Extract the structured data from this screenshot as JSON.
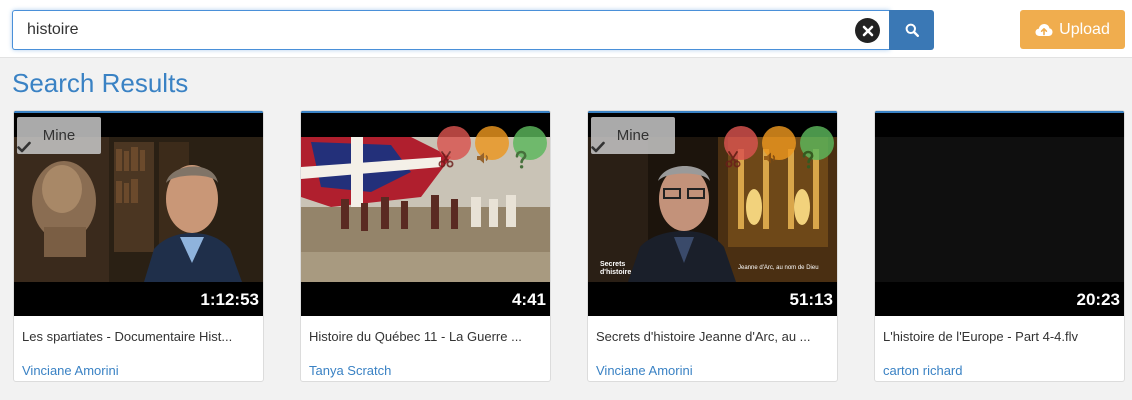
{
  "search": {
    "value": "histoire"
  },
  "header": {
    "upload_label": "Upload"
  },
  "main": {
    "title": "Search Results",
    "results": [
      {
        "mine": true,
        "mine_label": "Mine",
        "duration": "1:12:53",
        "title": "Les spartiates - Documentaire Hist...",
        "author": "Vinciane Amorini"
      },
      {
        "mine": false,
        "duration": "4:41",
        "title": "Histoire du Québec 11 - La Guerre ...",
        "author": "Tanya Scratch"
      },
      {
        "mine": true,
        "mine_label": "Mine",
        "duration": "51:13",
        "title": "Secrets d'histoire Jeanne d'Arc, au ...",
        "author": "Vinciane Amorini",
        "overlay_text_1": "Secrets d'histoire",
        "overlay_text_2": "Jeanne d'Arc, au nom de Dieu"
      },
      {
        "mine": false,
        "duration": "20:23",
        "title": "L'histoire de l'Europe - Part 4-4.flv",
        "author": "carton richard"
      }
    ]
  },
  "icons": {
    "clear": "close-circle-icon",
    "search": "search-icon",
    "upload": "cloud-upload-icon",
    "mine": "check-icon",
    "flags": [
      "scissors-icon",
      "volume-icon",
      "question-icon"
    ]
  },
  "colors": {
    "accent": "#3a82c4",
    "search_button": "#3a78b5",
    "upload_button": "#f0ad4e",
    "flag_red": "#d9534f",
    "flag_orange": "#ec971f",
    "flag_green": "#5cb85c"
  }
}
